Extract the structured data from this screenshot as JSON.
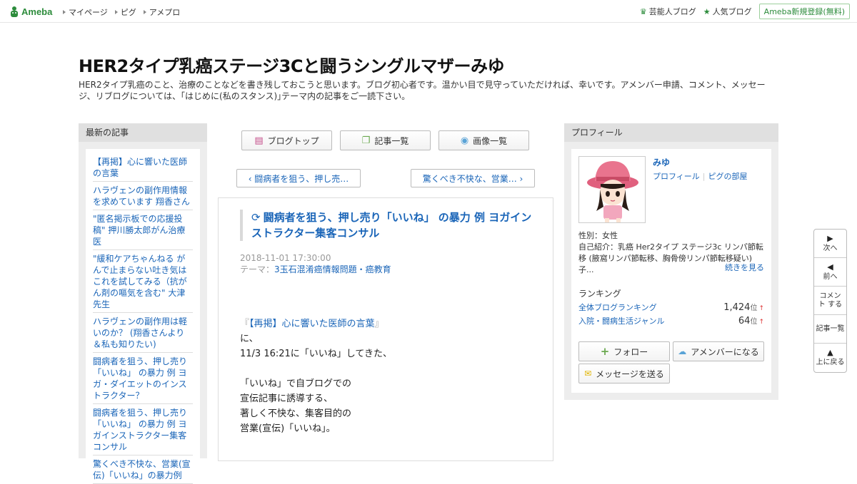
{
  "header": {
    "logo_text": "Ameba",
    "nav": [
      "マイページ",
      "ピグ",
      "アメプロ"
    ],
    "right_links": [
      {
        "icon": "crown-icon",
        "label": "芸能人ブログ"
      },
      {
        "icon": "star-icon",
        "label": "人気ブログ"
      }
    ],
    "signup_label": "Ameba新規登録(無料)"
  },
  "blog": {
    "title": "HER2タイプ乳癌ステージ3Cと闘うシングルマザーみゆ",
    "description": "HER2タイプ乳癌のこと、治療のことなどを書き残しておこうと思います。ブログ初心者です。温かい目で見守っていただければ、幸いです。アメンバー申請、コメント、メッセージ、リブログについては、｢はじめに(私のスタンス)｣テーマ内の記事をご一読下さい。"
  },
  "left_sidebar": {
    "heading": "最新の記事",
    "articles": [
      "【再掲】心に響いた医師の言葉",
      "ハラヴェンの副作用情報を求めています 翔香さん",
      "\"匿名掲示板での応援投稿\" 押川勝太郎がん治療医",
      "\"緩和ケアちゃんねる がんで止まらない吐き気はこれを試してみる（抗がん剤の嘔気を含む\" 大津先生",
      "ハラヴェンの副作用は軽いのか？ (翔香さんより＆私も知りたい)",
      "闘病者を狙う、押し売り「いいね」 の暴力 例 ヨガ・ダイエットのインストラクター？",
      "闘病者を狙う、押し売り「いいね」 の暴力 例 ヨガインストラクター集客コンサル",
      "驚くべき不快な、営業(宣伝)「いいね」の暴力例"
    ]
  },
  "center": {
    "nav_buttons": [
      {
        "icon": "document-icon",
        "label": "ブログトップ"
      },
      {
        "icon": "list-icon",
        "label": "記事一覧"
      },
      {
        "icon": "camera-icon",
        "label": "画像一覧"
      }
    ],
    "prev_label": "‹ 闘病者を狙う、押し売…",
    "next_label": "驚くべき不快な、営業… ›",
    "entry": {
      "title": "闘病者を狙う、押し売り「いいね」 の暴力 例 ヨガインストラクター集客コンサル",
      "datetime": "2018-11-01 17:30:00",
      "theme_prefix": "テーマ：",
      "theme": "3玉石混淆癌情報問題・癌教育",
      "body_quote_open": "『",
      "body_ref": "【再掲】心に響いた医師の言葉",
      "body_quote_close": "』",
      "body_lines": [
        "に、",
        "11/3 16:21に「いいね」してきた、",
        "",
        "「いいね」で自ブログでの",
        "宣伝記事に誘導する、",
        "著しく不快な、集客目的の",
        "営業(宣伝)「いいね」。"
      ]
    }
  },
  "right_sidebar": {
    "heading": "プロフィール",
    "name": "みゆ",
    "link_profile": "プロフィール",
    "link_sep": "|",
    "link_pig": "ピグの部屋",
    "gender": "性別：女性",
    "intro": "自己紹介：乳癌 Her2タイプ ステージ3c リンパ節転移 (腋窩リンパ節転移、胸骨傍リンパ節転移疑い) 子...",
    "more_label": "続きを見る",
    "ranking_heading": "ランキング",
    "rankings": [
      {
        "label": "全体ブログランキング",
        "value": "1,424",
        "unit": "位",
        "arrow": "↑"
      },
      {
        "label": "入院・闘病生活ジャンル",
        "value": "64",
        "unit": "位",
        "arrow": "↑"
      }
    ],
    "follow_label": "フォロー",
    "amember_label": "アメンバーになる",
    "message_label": "メッセージを送る"
  },
  "float_nav": [
    {
      "icon": "▶",
      "label": "次へ"
    },
    {
      "icon": "◀",
      "label": "前へ"
    },
    {
      "icon": "",
      "label": "コメント する"
    },
    {
      "icon": "",
      "label": "記事一覧"
    },
    {
      "icon": "▲",
      "label": "上に戻る"
    }
  ]
}
